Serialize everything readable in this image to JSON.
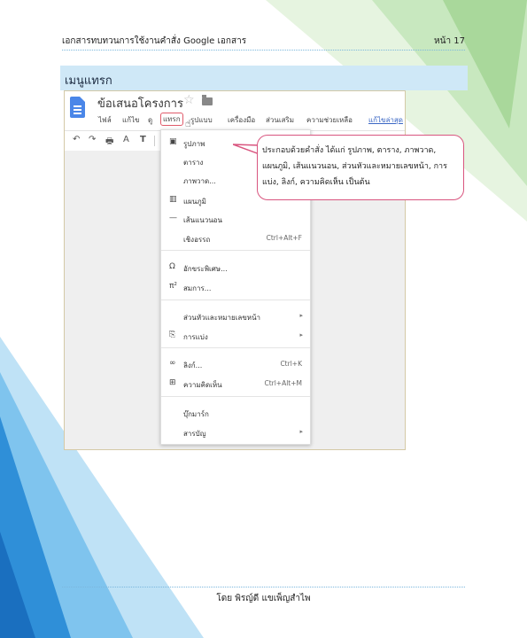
{
  "header": {
    "title": "เอกสารทบทวนการใช้งานคำสั่ง Google เอกสาร",
    "page": "หน้า 17"
  },
  "section": {
    "title": "เมนูแทรก"
  },
  "screenshot": {
    "doc_title": "ข้อเสนอโครงการ",
    "menus": [
      "ไฟล์",
      "แก้ไข",
      "ดู",
      "แทรก",
      "รูปแบบ",
      "เครื่องมือ",
      "ส่วนเสริม",
      "ความช่วยเหลือ",
      "แก้ไขล่าสุด"
    ],
    "insert_menu": [
      {
        "icon": "image-icon",
        "label": "รูปภาพ",
        "shortcut": "",
        "submenu": false
      },
      {
        "icon": "",
        "label": "ตาราง",
        "shortcut": "",
        "submenu": false
      },
      {
        "icon": "",
        "label": "ภาพวาด...",
        "shortcut": "",
        "submenu": false
      },
      {
        "icon": "chart-icon",
        "label": "แผนภูมิ",
        "shortcut": "",
        "submenu": false
      },
      {
        "icon": "horizontal-line-icon",
        "label": "เส้นแนวนอน",
        "shortcut": "",
        "submenu": false
      },
      {
        "icon": "",
        "label": "เชิงอรรถ",
        "shortcut": "Ctrl+Alt+F",
        "submenu": false
      },
      {
        "icon": "omega-icon",
        "label": "อักขระพิเศษ...",
        "shortcut": "",
        "submenu": false
      },
      {
        "icon": "equation-icon",
        "label": "สมการ...",
        "shortcut": "",
        "submenu": false
      },
      {
        "icon": "",
        "label": "ส่วนหัวและหมายเลขหน้า",
        "shortcut": "",
        "submenu": true
      },
      {
        "icon": "page-break-icon",
        "label": "การแบ่ง",
        "shortcut": "",
        "submenu": true
      },
      {
        "icon": "link-icon",
        "label": "ลิงก์...",
        "shortcut": "Ctrl+K",
        "submenu": false
      },
      {
        "icon": "comment-icon",
        "label": "ความคิดเห็น",
        "shortcut": "Ctrl+Alt+M",
        "submenu": false
      },
      {
        "icon": "",
        "label": "บุ๊กมาร์ก",
        "shortcut": "",
        "submenu": false
      },
      {
        "icon": "",
        "label": "สารบัญ",
        "shortcut": "",
        "submenu": true
      }
    ],
    "icons": {
      "undo": "↶",
      "redo": "↷",
      "print": "🖶",
      "spellcheck": "A",
      "paint_format": "T"
    }
  },
  "callout": {
    "text": "ประกอบด้วยคำสั่ง ได้แก่ รูปภาพ, ตาราง, ภาพวาด, แผนภูมิ, เส้นแนวนอน, ส่วนหัวและหมายเลขหน้า, การแบ่ง, ลิงก์, ความคิดเห็น เป็นต้น"
  },
  "footer": {
    "text": "โดย พิรญ์ดี แขเพ็ญสำไพ"
  },
  "colors": {
    "accent_blue": "#4a86e8",
    "highlight": "#e05a6a",
    "section_bg": "#cfe8f7",
    "deco_blue": "#2f8fd8",
    "deco_green": "#bfe3b1"
  }
}
